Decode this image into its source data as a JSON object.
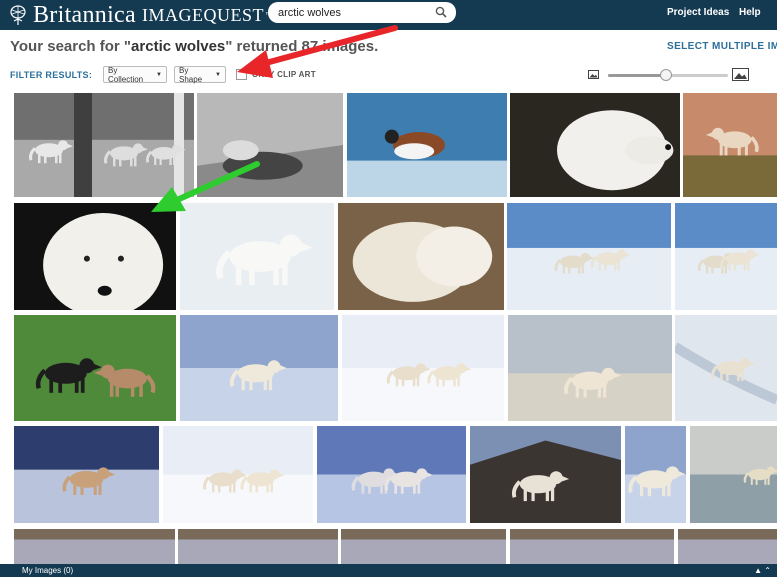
{
  "app": {
    "brand": "Britannica",
    "product": "IMAGEQUEST",
    "tm": "™"
  },
  "search": {
    "value": "arctic wolves"
  },
  "nav": {
    "project_ideas": "Project Ideas",
    "help": "Help"
  },
  "results": {
    "prefix": "Your search for \"",
    "query": "arctic wolves",
    "suffix": "\" returned 87 images.",
    "select_multiple": "SELECT MULTIPLE IM"
  },
  "filters": {
    "label": "FILTER RESULTS:",
    "by_collection": "By Collection",
    "by_shape": "By Shape",
    "clip_art": "ONLY CLIP ART"
  },
  "zoom": {
    "level": 0.48
  },
  "footer": {
    "my_images": "My Images (0)"
  },
  "annotations": {
    "red_arrow_color": "#e8262a",
    "green_arrow_color": "#2ecc2e"
  },
  "thumbnails": [
    {
      "kind": "bw-forest"
    },
    {
      "kind": "bw-rocks"
    },
    {
      "kind": "bird"
    },
    {
      "kind": "wolf-portrait-dark"
    },
    {
      "kind": "wolf-rocky"
    },
    {
      "kind": "wolf-closeup"
    },
    {
      "kind": "wolf-snow"
    },
    {
      "kind": "wolves-pair-brown"
    },
    {
      "kind": "wolves-tundra"
    },
    {
      "kind": "wolves-tundra"
    },
    {
      "kind": "wolves-grass"
    },
    {
      "kind": "wolf-blue"
    },
    {
      "kind": "wolves-snow-pair"
    },
    {
      "kind": "wolves-rocky-tundra"
    },
    {
      "kind": "wolves-snowtrack"
    },
    {
      "kind": "wolves-sunset"
    },
    {
      "kind": "wolves-snow-pair"
    },
    {
      "kind": "wolves-blue"
    },
    {
      "kind": "wolf-rock"
    },
    {
      "kind": "wolf-blue"
    },
    {
      "kind": "wolf-river"
    },
    {
      "kind": "partial"
    },
    {
      "kind": "partial"
    },
    {
      "kind": "partial"
    },
    {
      "kind": "partial"
    },
    {
      "kind": "partial"
    }
  ]
}
